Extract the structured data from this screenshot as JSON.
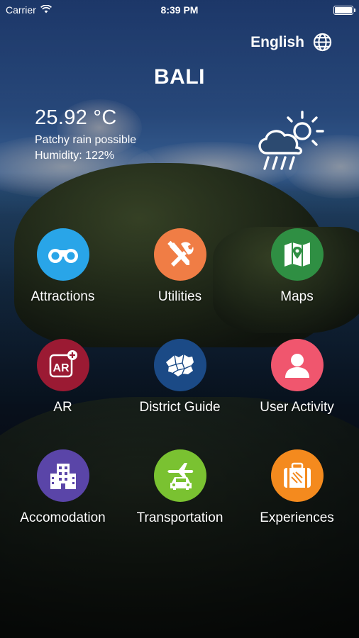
{
  "status_bar": {
    "carrier": "Carrier",
    "time": "8:39 PM",
    "battery_level": 1.0
  },
  "language": {
    "label": "English",
    "icon": "globe-icon"
  },
  "city": "BALI",
  "weather": {
    "temperature": "25.92 °C",
    "condition": "Patchy rain possible",
    "humidity": "Humidity: 122%",
    "icon": "rain-sun-icon"
  },
  "menu": [
    {
      "label": "Attractions",
      "icon": "binoculars-icon",
      "color": "#29a5e8"
    },
    {
      "label": "Utilities",
      "icon": "tools-icon",
      "color": "#f07d45"
    },
    {
      "label": "Maps",
      "icon": "map-icon",
      "color": "#2f8f43"
    },
    {
      "label": "AR",
      "icon": "ar-icon",
      "color": "#9b1a33"
    },
    {
      "label": "District Guide",
      "icon": "district-map-icon",
      "color": "#1b4a86"
    },
    {
      "label": "User Activity",
      "icon": "user-icon",
      "color": "#f0566e"
    },
    {
      "label": "Accomodation",
      "icon": "building-icon",
      "color": "#5a45a8"
    },
    {
      "label": "Transportation",
      "icon": "plane-car-icon",
      "color": "#7ac231"
    },
    {
      "label": "Experiences",
      "icon": "suitcase-icon",
      "color": "#f48a1e"
    }
  ]
}
